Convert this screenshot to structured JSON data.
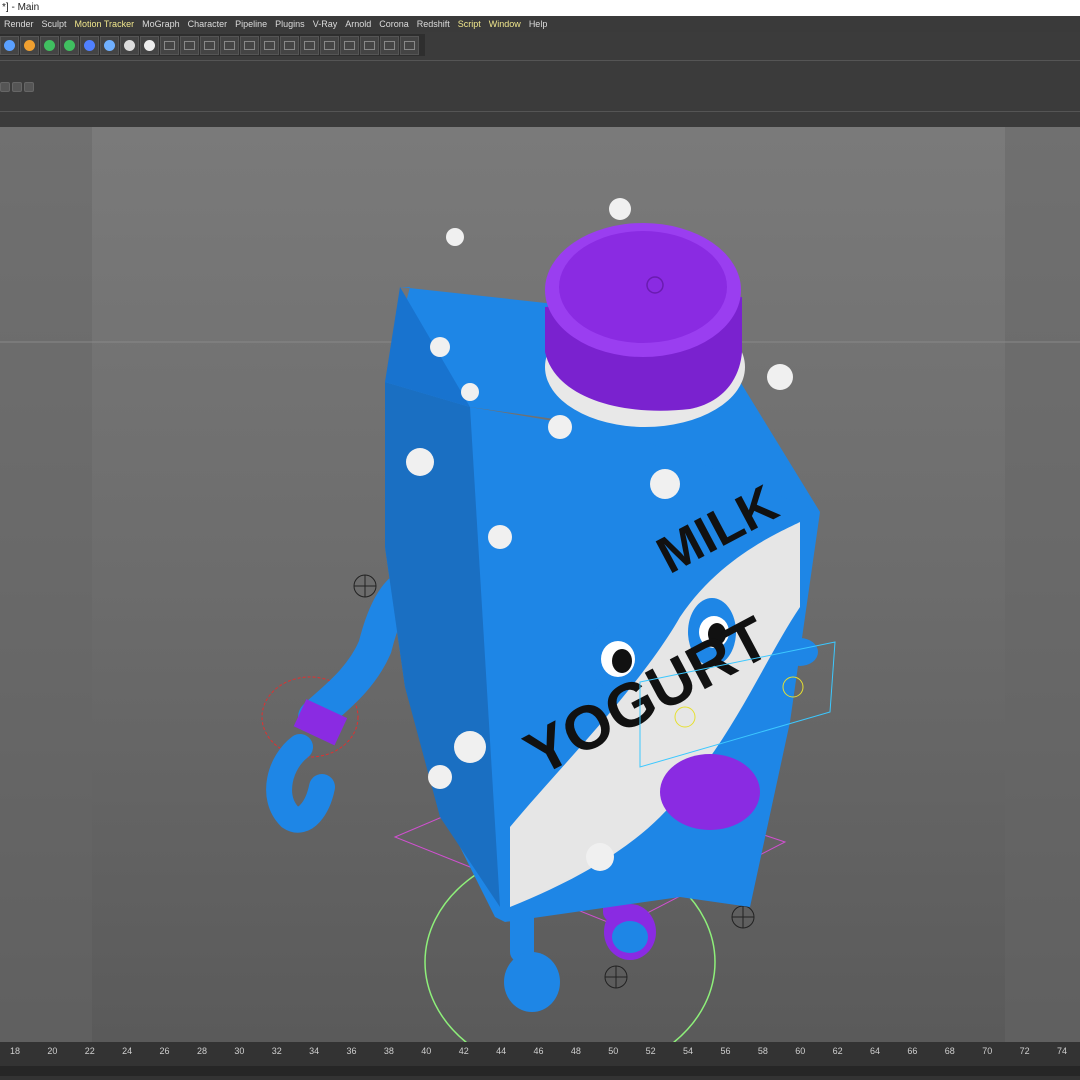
{
  "window": {
    "title": "Main",
    "title_prefix": "*]"
  },
  "menu": [
    {
      "label": "Render",
      "highlight": false
    },
    {
      "label": "Sculpt",
      "highlight": false
    },
    {
      "label": "Motion Tracker",
      "highlight": true
    },
    {
      "label": "MoGraph",
      "highlight": false
    },
    {
      "label": "Character",
      "highlight": false
    },
    {
      "label": "Pipeline",
      "highlight": false
    },
    {
      "label": "Plugins",
      "highlight": false
    },
    {
      "label": "V-Ray",
      "highlight": false
    },
    {
      "label": "Arnold",
      "highlight": false
    },
    {
      "label": "Corona",
      "highlight": false
    },
    {
      "label": "Redshift",
      "highlight": false
    },
    {
      "label": "Script",
      "highlight": true
    },
    {
      "label": "Window",
      "highlight": true
    },
    {
      "label": "Help",
      "highlight": false
    }
  ],
  "toolbar_icons": [
    "cube-icon",
    "pen-icon",
    "subdivision-icon",
    "cloner-icon",
    "deformer-icon",
    "floor-icon",
    "camera-icon",
    "light-icon",
    "grid-icon",
    "tool-icon",
    "tool-icon",
    "tool-icon",
    "tool-icon",
    "tool-icon",
    "tool-icon",
    "tool-icon",
    "tool-icon",
    "tool-icon",
    "tool-icon",
    "tool-icon",
    "tool-icon"
  ],
  "viewport": {
    "model": {
      "text_line1": "MILK",
      "text_line2": "YOGURT"
    },
    "colors": {
      "carton": "#1e86e6",
      "cap": "#8a2be2",
      "splash": "#e8e8e8",
      "bg": "#6f6f6f"
    }
  },
  "timeline": {
    "ticks": [
      "18",
      "20",
      "22",
      "24",
      "26",
      "28",
      "30",
      "32",
      "34",
      "36",
      "38",
      "40",
      "42",
      "44",
      "46",
      "48",
      "50",
      "52",
      "54",
      "56",
      "58",
      "60",
      "62",
      "64",
      "66",
      "68",
      "70",
      "72",
      "74"
    ]
  }
}
